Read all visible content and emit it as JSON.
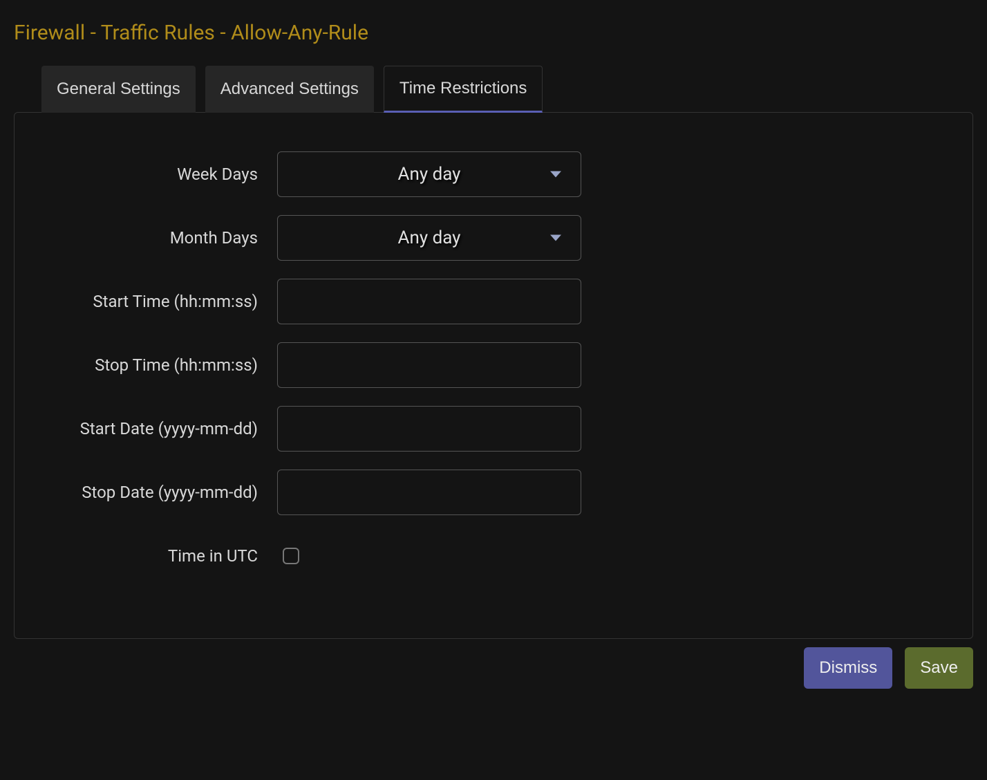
{
  "header": {
    "title": "Firewall - Traffic Rules - Allow-Any-Rule"
  },
  "tabs": {
    "general": "General Settings",
    "advanced": "Advanced Settings",
    "time": "Time Restrictions"
  },
  "form": {
    "week_days": {
      "label": "Week Days",
      "value": "Any day"
    },
    "month_days": {
      "label": "Month Days",
      "value": "Any day"
    },
    "start_time": {
      "label": "Start Time (hh:mm:ss)",
      "value": ""
    },
    "stop_time": {
      "label": "Stop Time (hh:mm:ss)",
      "value": ""
    },
    "start_date": {
      "label": "Start Date (yyyy-mm-dd)",
      "value": ""
    },
    "stop_date": {
      "label": "Stop Date (yyyy-mm-dd)",
      "value": ""
    },
    "time_utc": {
      "label": "Time in UTC",
      "checked": false
    }
  },
  "footer": {
    "dismiss": "Dismiss",
    "save": "Save"
  }
}
